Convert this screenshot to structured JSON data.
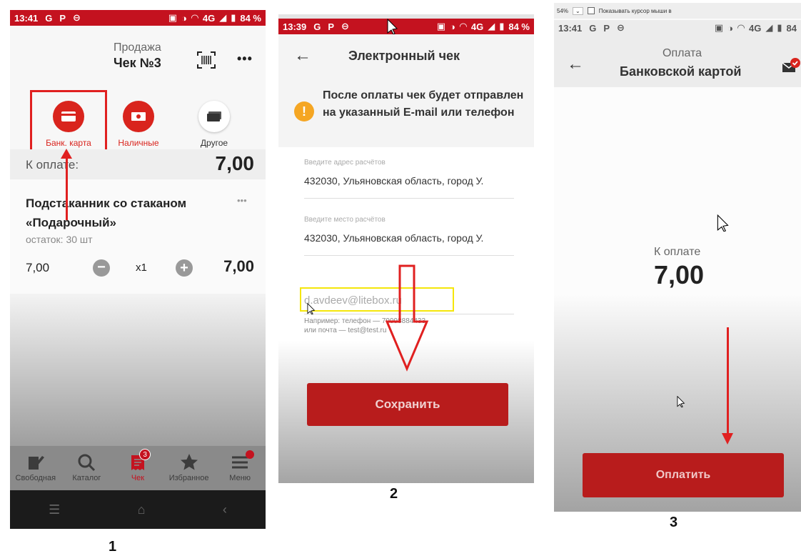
{
  "screen1": {
    "status": {
      "time": "13:41",
      "left_icons": [
        "G",
        "P",
        "⊖"
      ],
      "net": "4G",
      "battery": "84 %"
    },
    "header": {
      "subtitle": "Продажа",
      "title": "Чек №3",
      "more": "•••"
    },
    "payment_methods": [
      {
        "label": "Банк. карта",
        "icon": "card-icon",
        "color": "#d9241d"
      },
      {
        "label": "Наличные",
        "icon": "cash-icon",
        "color": "#d9241d"
      },
      {
        "label": "Другое",
        "icon": "wallet-icon",
        "color": "#333333"
      }
    ],
    "total_label": "К оплате:",
    "total_value": "7,00",
    "item": {
      "name": "Подстаканник со стаканом «Подарочный»",
      "stock": "остаток: 30 шт",
      "price": "7,00",
      "qty": "x1",
      "sum": "7,00",
      "more": "•••"
    },
    "nav": [
      {
        "label": "Свободная",
        "icon": "pencil-icon"
      },
      {
        "label": "Каталог",
        "icon": "search-icon"
      },
      {
        "label": "Чек",
        "icon": "receipt-icon",
        "badge": "3"
      },
      {
        "label": "Избранное",
        "icon": "star-icon"
      },
      {
        "label": "Меню",
        "icon": "menu-icon"
      }
    ],
    "number": "1"
  },
  "screen2": {
    "status": {
      "time": "13:39",
      "left_icons": [
        "G",
        "P",
        "⊖"
      ],
      "net": "4G",
      "battery": "84 %"
    },
    "title": "Электронный чек",
    "notice": "После оплаты чек будет отправлен на указанный E-mail или телефон",
    "address_label": "Введите адрес расчётов",
    "address_value": "432030, Ульяновская область, город У.",
    "place_label": "Введите место расчётов",
    "place_value": "432030, Ульяновская область, город У.",
    "email_value": "d.avdeev@litebox.ru",
    "hint_line1": "Например: телефон — 79998884433",
    "hint_line2": "или почта — test@test.ru",
    "save_label": "Сохранить",
    "number": "2"
  },
  "screen3": {
    "top_strip": {
      "zoom": "54%",
      "checkbox_label": "Показывать курсор мыши в"
    },
    "status": {
      "time": "13:41",
      "left_icons": [
        "G",
        "P",
        "⊖"
      ],
      "net": "4G",
      "battery": "84"
    },
    "subtitle": "Оплата",
    "title": "Банковской картой",
    "total_label": "К оплате",
    "total_value": "7,00",
    "pay_label": "Оплатить",
    "number": "3"
  },
  "colors": {
    "brand_red": "#c4121f",
    "button_red": "#b81c1c",
    "highlight_yellow": "#f5e60a",
    "warning": "#f5a623"
  }
}
